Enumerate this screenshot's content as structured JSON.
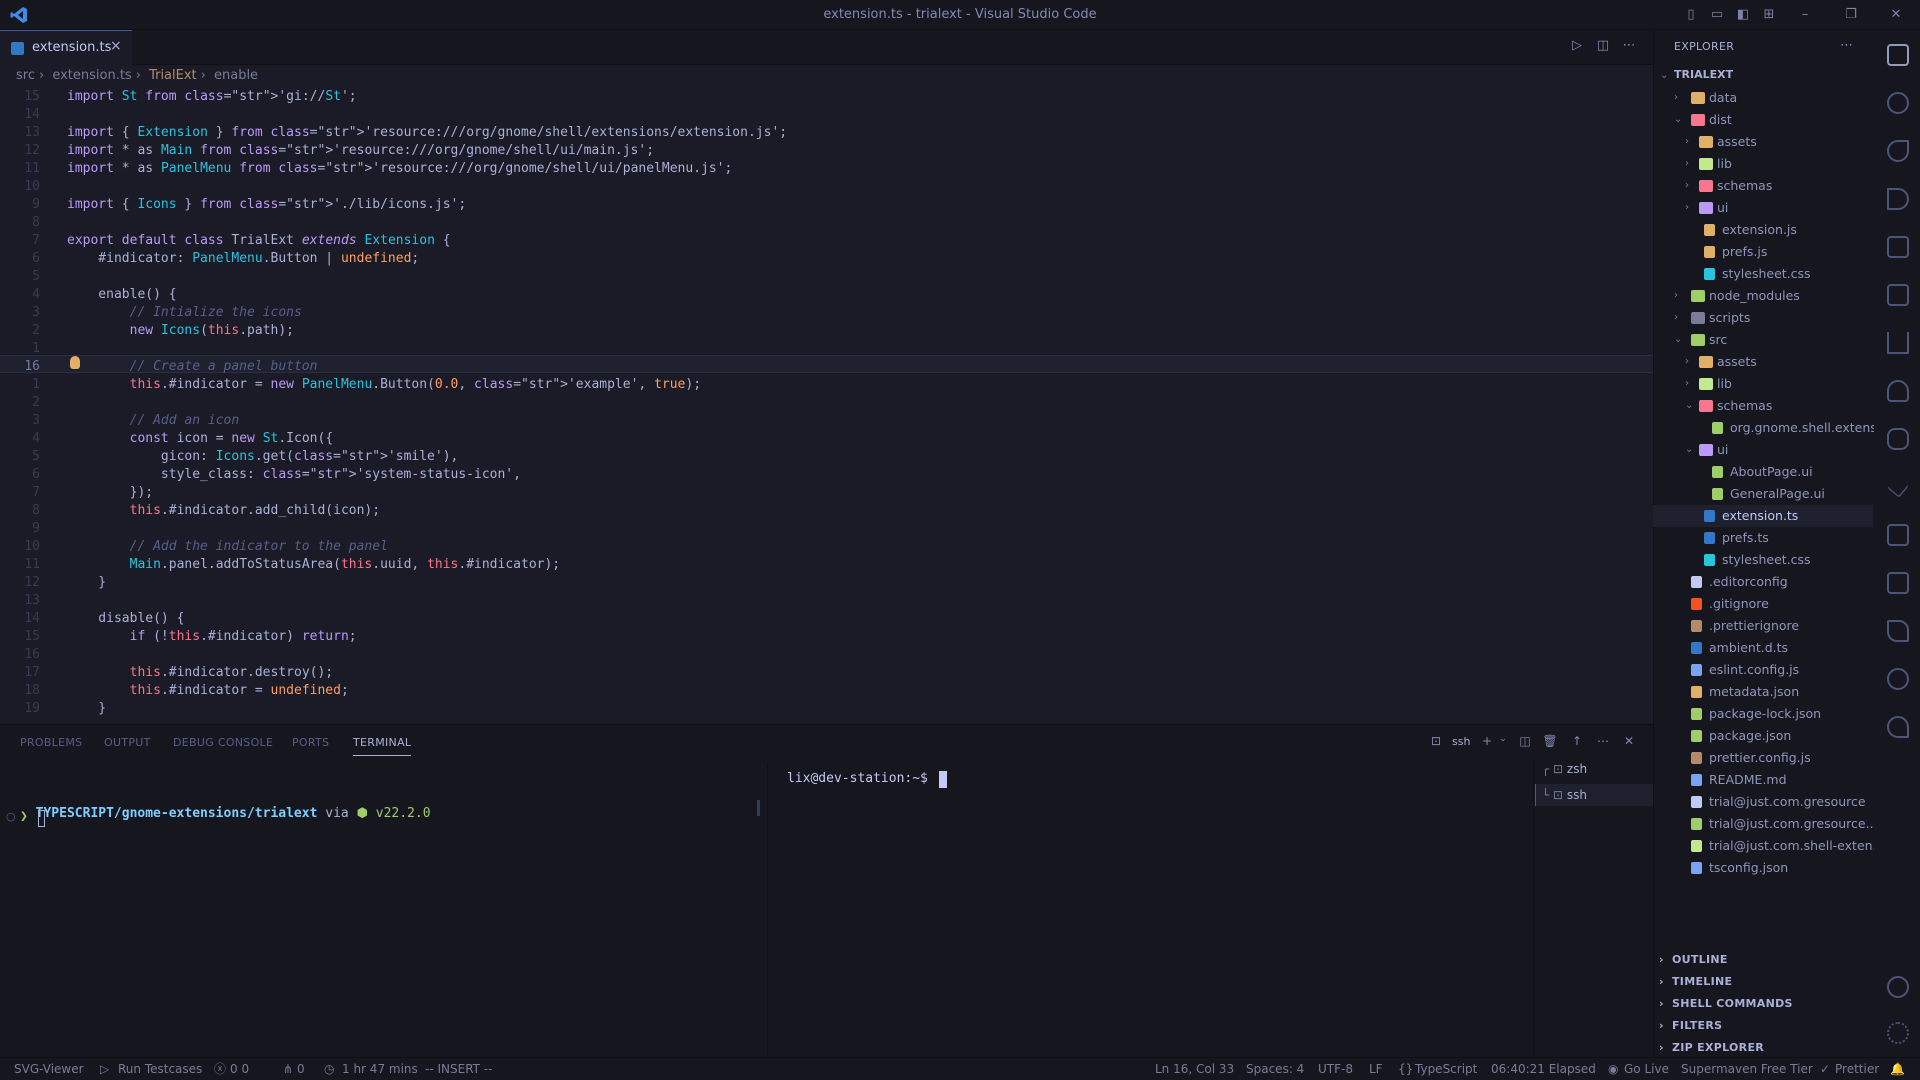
{
  "window": {
    "title": "extension.ts - trialext - Visual Studio Code"
  },
  "tab": {
    "label": "extension.ts",
    "close": "×"
  },
  "breadcrumb": {
    "seg1": "src",
    "seg2": "extension.ts",
    "seg3": "TrialExt",
    "seg4": "enable"
  },
  "editor": {
    "line_numbers": [
      "15",
      "14",
      "13",
      "12",
      "11",
      "10",
      "9",
      "8",
      "7",
      "6",
      "5",
      "4",
      "3",
      "2",
      "1",
      "16",
      "1",
      "2",
      "3",
      "4",
      "5",
      "6",
      "7",
      "8",
      "9",
      "10",
      "11",
      "12",
      "13",
      "14",
      "15",
      "16",
      "17",
      "18",
      "19"
    ],
    "lines": [
      "import St from 'gi://St';",
      "",
      "import { Extension } from 'resource:///org/gnome/shell/extensions/extension.js';",
      "import * as Main from 'resource:///org/gnome/shell/ui/main.js';",
      "import * as PanelMenu from 'resource:///org/gnome/shell/ui/panelMenu.js';",
      "",
      "import { Icons } from './lib/icons.js';",
      "",
      "export default class TrialExt extends Extension {",
      "    #indicator: PanelMenu.Button | undefined;",
      "",
      "    enable() {",
      "        // Intialize the icons",
      "        new Icons(this.path);",
      "",
      "        // Create a panel button",
      "        this.#indicator = new PanelMenu.Button(0.0, 'example', true);",
      "",
      "        // Add an icon",
      "        const icon = new St.Icon({",
      "            gicon: Icons.get('smile'),",
      "            style_class: 'system-status-icon',",
      "        });",
      "        this.#indicator.add_child(icon);",
      "",
      "        // Add the indicator to the panel",
      "        Main.panel.addToStatusArea(this.uuid, this.#indicator);",
      "    }",
      "",
      "    disable() {",
      "        if (!this.#indicator) return;",
      "",
      "        this.#indicator.destroy();",
      "        this.#indicator = undefined;",
      "    }"
    ]
  },
  "panel": {
    "tabs": [
      "PROBLEMS",
      "OUTPUT",
      "DEBUG CONSOLE",
      "PORTS",
      "TERMINAL"
    ],
    "term_label": "ssh",
    "terminal_left": {
      "path": "TYPESCRIPT/gnome-extensions/trialext",
      "via": " via ",
      "node": "v22.2.0",
      "prompt": "❯"
    },
    "terminal_right": {
      "prompt": "lix@dev-station:~$"
    },
    "term_instances": [
      "zsh",
      "ssh"
    ]
  },
  "explorer": {
    "header": "EXPLORER",
    "root": "TRIALEXT",
    "items": [
      {
        "label": "data",
        "depth": 0,
        "type": "folder",
        "open": false,
        "color": "#e0af68"
      },
      {
        "label": "dist",
        "depth": 0,
        "type": "folder",
        "open": true,
        "color": "#f7768e"
      },
      {
        "label": "assets",
        "depth": 1,
        "type": "folder",
        "open": false,
        "color": "#e0af68"
      },
      {
        "label": "lib",
        "depth": 1,
        "type": "folder",
        "open": false,
        "color": "#c3e88d"
      },
      {
        "label": "schemas",
        "depth": 1,
        "type": "folder",
        "open": false,
        "color": "#f7768e"
      },
      {
        "label": "ui",
        "depth": 1,
        "type": "folder",
        "open": false,
        "color": "#bb9af7"
      },
      {
        "label": "extension.js",
        "depth": 1,
        "type": "file",
        "color": "#e0af68"
      },
      {
        "label": "prefs.js",
        "depth": 1,
        "type": "file",
        "color": "#e0af68"
      },
      {
        "label": "stylesheet.css",
        "depth": 1,
        "type": "file",
        "color": "#2ac3de"
      },
      {
        "label": "node_modules",
        "depth": 0,
        "type": "folder",
        "open": false,
        "color": "#9ece6a"
      },
      {
        "label": "scripts",
        "depth": 0,
        "type": "folder",
        "open": false,
        "color": "#787c99"
      },
      {
        "label": "src",
        "depth": 0,
        "type": "folder",
        "open": true,
        "color": "#9ece6a"
      },
      {
        "label": "assets",
        "depth": 1,
        "type": "folder",
        "open": false,
        "color": "#e0af68"
      },
      {
        "label": "lib",
        "depth": 1,
        "type": "folder",
        "open": false,
        "color": "#c3e88d"
      },
      {
        "label": "schemas",
        "depth": 1,
        "type": "folder",
        "open": true,
        "color": "#f7768e"
      },
      {
        "label": "org.gnome.shell.extens...",
        "depth": 2,
        "type": "file",
        "color": "#9ece6a"
      },
      {
        "label": "ui",
        "depth": 1,
        "type": "folder",
        "open": true,
        "color": "#bb9af7"
      },
      {
        "label": "AboutPage.ui",
        "depth": 2,
        "type": "file",
        "color": "#9ece6a"
      },
      {
        "label": "GeneralPage.ui",
        "depth": 2,
        "type": "file",
        "color": "#9ece6a"
      },
      {
        "label": "extension.ts",
        "depth": 1,
        "type": "file",
        "color": "#3178c6"
      },
      {
        "label": "prefs.ts",
        "depth": 1,
        "type": "file",
        "color": "#3178c6"
      },
      {
        "label": "stylesheet.css",
        "depth": 1,
        "type": "file",
        "color": "#2ac3de"
      },
      {
        "label": ".editorconfig",
        "depth": 0,
        "type": "file",
        "color": "#c0caf5"
      },
      {
        "label": ".gitignore",
        "depth": 0,
        "type": "file",
        "color": "#f4511e"
      },
      {
        "label": ".prettierignore",
        "depth": 0,
        "type": "file",
        "color": "#b48b6a"
      },
      {
        "label": "ambient.d.ts",
        "depth": 0,
        "type": "file",
        "color": "#3178c6"
      },
      {
        "label": "eslint.config.js",
        "depth": 0,
        "type": "file",
        "color": "#7aa2f7"
      },
      {
        "label": "metadata.json",
        "depth": 0,
        "type": "file",
        "color": "#e0af68"
      },
      {
        "label": "package-lock.json",
        "depth": 0,
        "type": "file",
        "color": "#9ece6a"
      },
      {
        "label": "package.json",
        "depth": 0,
        "type": "file",
        "color": "#9ece6a"
      },
      {
        "label": "prettier.config.js",
        "depth": 0,
        "type": "file",
        "color": "#b48b6a"
      },
      {
        "label": "README.md",
        "depth": 0,
        "type": "file",
        "color": "#7aa2f7"
      },
      {
        "label": "trial@just.com.gresource",
        "depth": 0,
        "type": "file",
        "color": "#c0caf5"
      },
      {
        "label": "trial@just.com.gresource...",
        "depth": 0,
        "type": "file",
        "color": "#9ece6a"
      },
      {
        "label": "trial@just.com.shell-exten...",
        "depth": 0,
        "type": "file",
        "color": "#c3e88d"
      },
      {
        "label": "tsconfig.json",
        "depth": 0,
        "type": "file",
        "color": "#7aa2f7"
      }
    ],
    "sections": [
      "OUTLINE",
      "TIMELINE",
      "SHELL COMMANDS",
      "FILTERS",
      "ZIP EXPLORER"
    ]
  },
  "status": {
    "svg": "SVG-Viewer",
    "run": "Run Testcases",
    "problems": "0 0",
    "ports": "0",
    "time": "1 hr 47 mins",
    "mode": "-- INSERT --",
    "pos": "Ln 16, Col 33",
    "spaces": "Spaces: 4",
    "enc": "UTF-8",
    "eol": "LF",
    "lang": "TypeScript",
    "elapsed": "06:40:21 Elapsed",
    "golive": "Go Live",
    "maven": "Supermaven Free Tier",
    "prettier": "Prettier"
  }
}
